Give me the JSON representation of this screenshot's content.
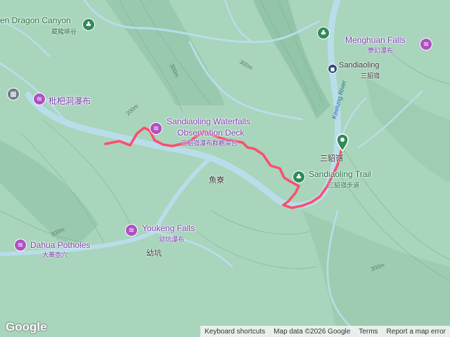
{
  "map": {
    "places": {
      "golden_dragon_canyon_en": "en Dragon Canyon",
      "golden_dragon_canyon_zh": "蔵龍峡谷",
      "menghuan_falls_en": "Menghuan Falls",
      "menghuan_falls_zh": "夢幻瀑布",
      "sandiaoling_en": "Sandiaoling",
      "sandiaoling_zh": "三貂嶺",
      "pipa_falls_zh": "枇杷洞瀑布",
      "obs_deck_en_line1": "Sandiaoling Waterfalls",
      "obs_deck_en_line2": "Observation Deck",
      "obs_deck_zh": "三貂嶺瀑布群觀景台",
      "sandiaoling_trail_en": "Sandiaoling Trail",
      "sandiaoling_trail_zh": "三貂嶺步道",
      "sandiaoling_village": "三貂嶺",
      "yuliao": "魚寮",
      "youkeng_falls_en": "Youkeng Falls",
      "youkeng_falls_zh": "幼坑瀑布",
      "youkeng": "幼坑",
      "dahua_potholes_en": "Dahua Potholes",
      "dahua_potholes_zh": "大華壺穴",
      "keelung_river": "Keelung River"
    },
    "contours": {
      "c300_a": "300m",
      "c300_b": "300m",
      "c300_c": "300m",
      "c200_a": "200m",
      "c200_b": "200m"
    }
  },
  "icons": {
    "waterfall_pin": "waterfall-icon",
    "park_pin": "tree-icon",
    "museum_pin": "museum-icon",
    "train_pin": "train-station-icon",
    "start_marker": "trail-start-marker-icon"
  },
  "colors": {
    "terrain": "#a8d5bb",
    "river": "#b9dde9",
    "track": "#ff4d6d",
    "poi": "#b04fc3"
  },
  "footer": {
    "logo": "Google",
    "keyboard_shortcuts": "Keyboard shortcuts",
    "map_data": "Map data ©2026 Google",
    "terms": "Terms",
    "report": "Report a map error"
  }
}
